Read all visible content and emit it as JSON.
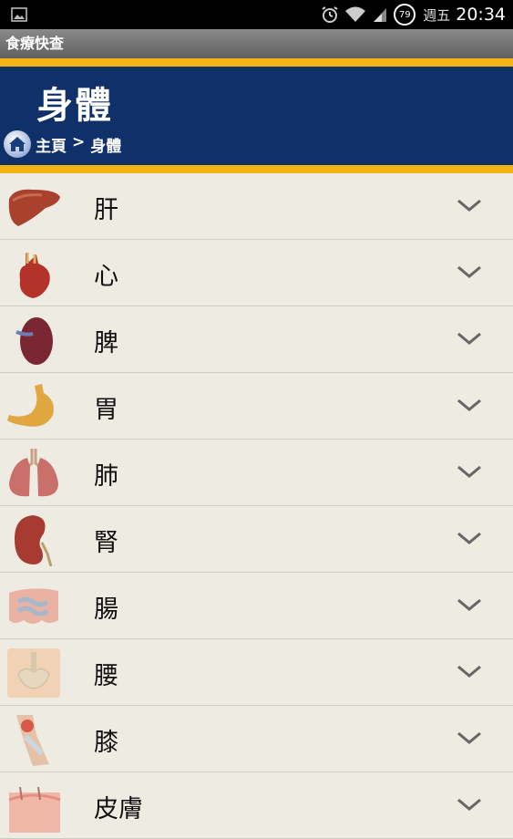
{
  "status_bar": {
    "weekday": "週五",
    "time": "20:34",
    "battery": "79"
  },
  "app": {
    "title": "食療快查"
  },
  "header": {
    "title": "身體",
    "breadcrumb": {
      "home": "主頁",
      "separator": ">",
      "current": "身體"
    }
  },
  "colors": {
    "navy": "#10306a",
    "gold": "#f2b316",
    "background": "#eeebe2"
  },
  "items": [
    {
      "label": "肝",
      "icon": "liver-icon"
    },
    {
      "label": "心",
      "icon": "heart-icon"
    },
    {
      "label": "脾",
      "icon": "spleen-icon"
    },
    {
      "label": "胃",
      "icon": "stomach-icon"
    },
    {
      "label": "肺",
      "icon": "lungs-icon"
    },
    {
      "label": "腎",
      "icon": "kidney-icon"
    },
    {
      "label": "腸",
      "icon": "intestine-icon"
    },
    {
      "label": "腰",
      "icon": "lower-back-icon"
    },
    {
      "label": "膝",
      "icon": "knee-icon"
    },
    {
      "label": "皮膚",
      "icon": "skin-icon"
    }
  ]
}
